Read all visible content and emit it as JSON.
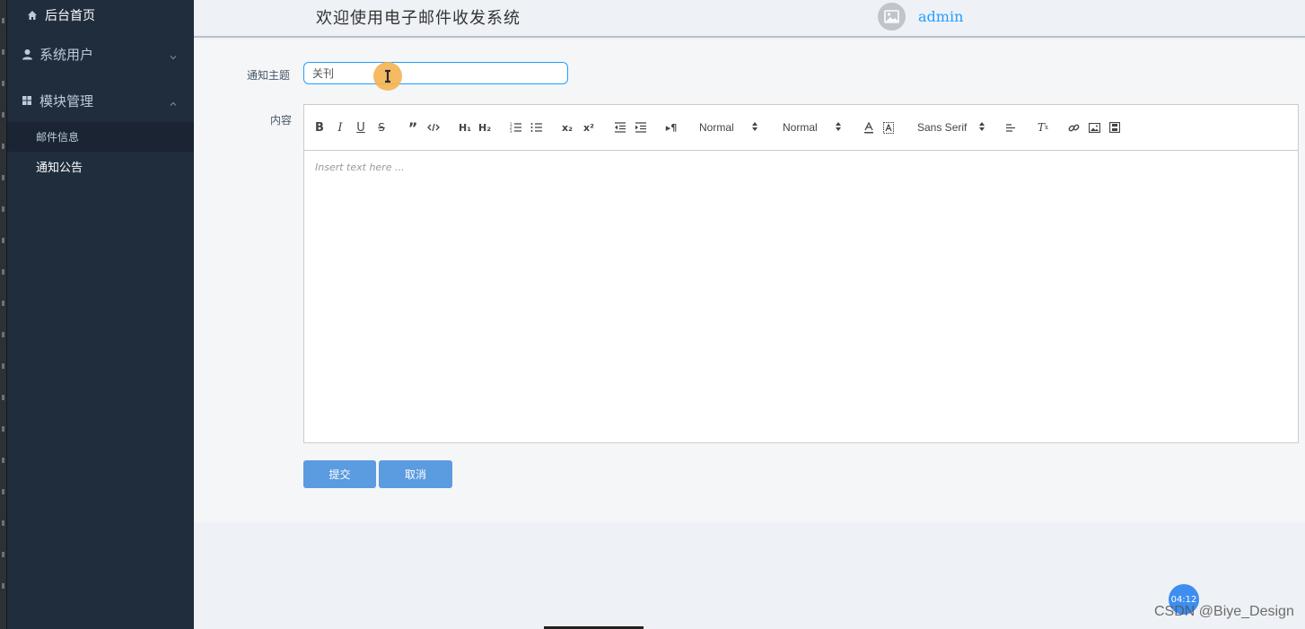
{
  "sidebar": {
    "home": "后台首页",
    "system_users": "系统用户",
    "module_management": "模块管理",
    "sub_items": [
      "邮件信息",
      "通知公告"
    ]
  },
  "header": {
    "title": "欢迎使用电子邮件收发系统",
    "username": "admin"
  },
  "form": {
    "subject_label": "通知主题",
    "subject_value": "关刊",
    "content_label": "内容",
    "editor_placeholder": "Insert text here ...",
    "toolbar": {
      "header_picker": "Normal",
      "size_picker": "Normal",
      "font_picker": "Sans Serif"
    },
    "submit_label": "提交",
    "cancel_label": "取消"
  },
  "overlay": {
    "timer": "04:12",
    "watermark": "CSDN @Biye_Design"
  },
  "colors": {
    "sidebar_bg": "#1f2d3d",
    "accent": "#20a0ff",
    "button": "#5b9bdf"
  }
}
